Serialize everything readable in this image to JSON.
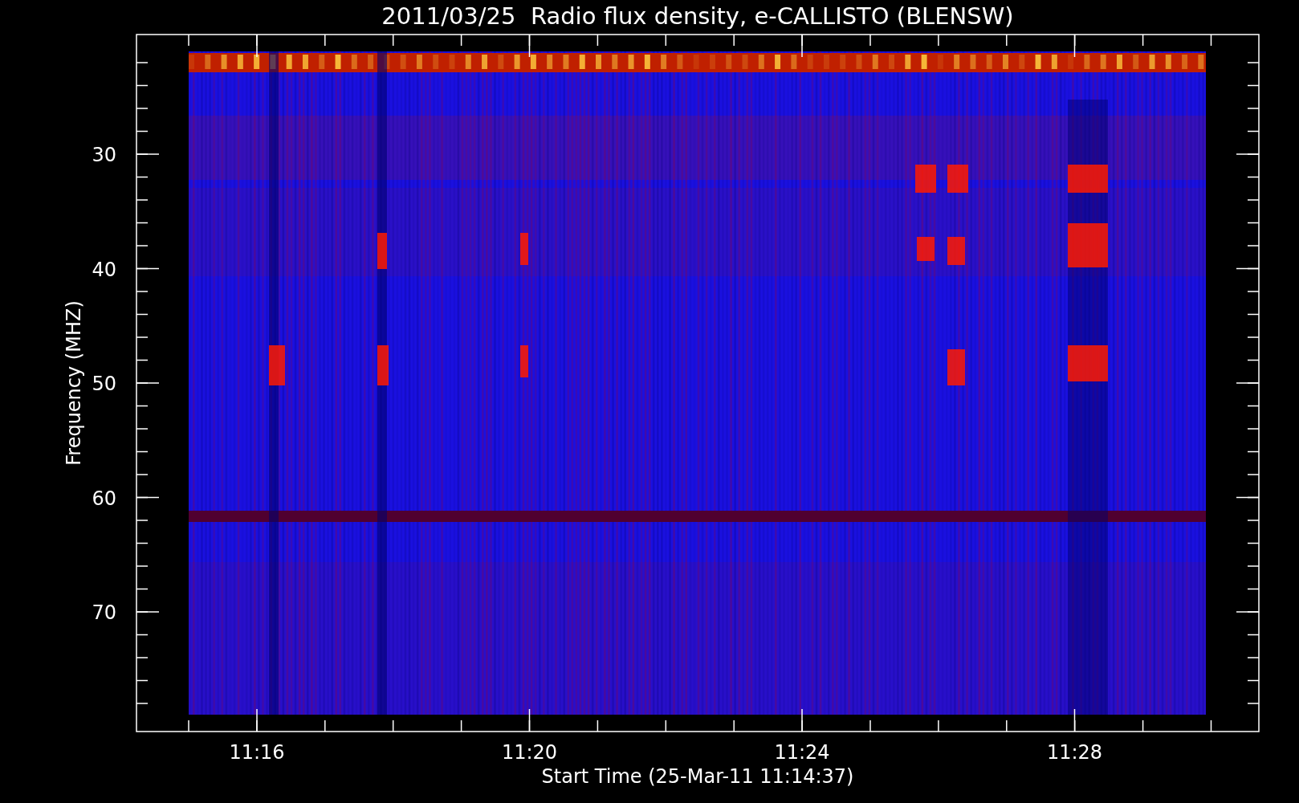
{
  "title": "2011/03/25  Radio flux density, e-CALLISTO (BLENSW)",
  "plot": {
    "ylabel": "Frequency (MHZ)",
    "xlabel": "Start Time (25-Mar-11 11:14:37)",
    "yticks": [
      "30",
      "40",
      "50",
      "60",
      "70"
    ],
    "xticks": [
      "11:16",
      "11:20",
      "11:24",
      "11:28"
    ]
  }
}
